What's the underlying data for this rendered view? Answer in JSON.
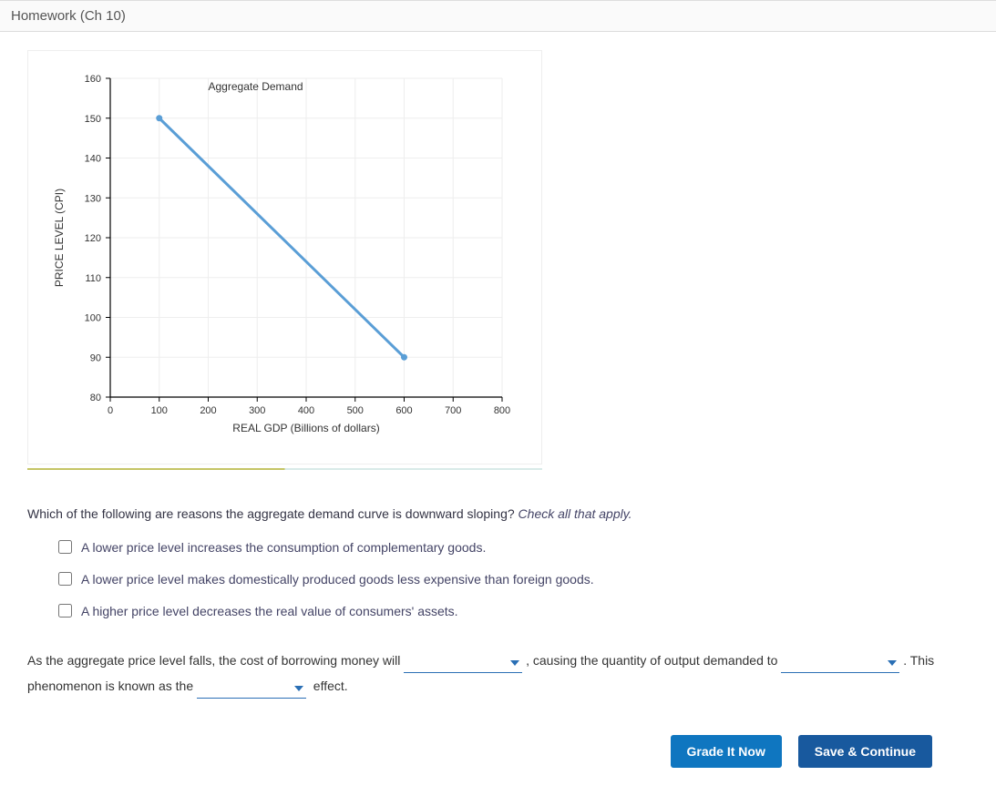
{
  "header": {
    "title": "Homework (Ch 10)"
  },
  "chart_data": {
    "type": "line",
    "title": "",
    "series_label": "Aggregate Demand",
    "xlabel": "REAL GDP (Billions of dollars)",
    "ylabel": "PRICE LEVEL (CPI)",
    "x_ticks": [
      0,
      100,
      200,
      300,
      400,
      500,
      600,
      700,
      800
    ],
    "y_ticks": [
      80,
      90,
      100,
      110,
      120,
      130,
      140,
      150,
      160
    ],
    "xlim": [
      0,
      800
    ],
    "ylim": [
      80,
      160
    ],
    "x": [
      100,
      600
    ],
    "y": [
      150,
      90
    ],
    "color": "#5a9ed6"
  },
  "q1": {
    "prompt": "Which of the following are reasons the aggregate demand curve is downward sloping?",
    "hint": "Check all that apply.",
    "options": [
      "A lower price level increases the consumption of complementary goods.",
      "A lower price level makes domestically produced goods less expensive than foreign goods.",
      "A higher price level decreases the real value of consumers' assets."
    ]
  },
  "q2": {
    "t1": "As the aggregate price level falls, the cost of borrowing money will",
    "t2": ", causing the quantity of output demanded to",
    "t3": ". This phenomenon is known as the",
    "t4": "effect."
  },
  "buttons": {
    "grade": "Grade It Now",
    "save": "Save & Continue"
  }
}
